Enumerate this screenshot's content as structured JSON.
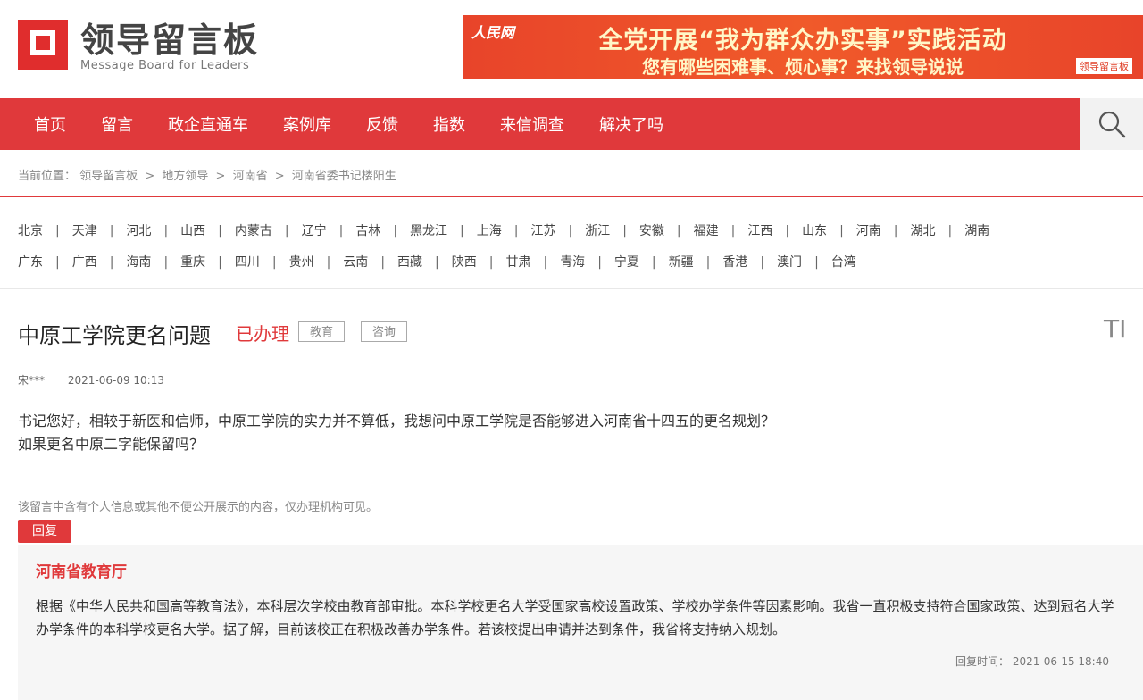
{
  "header": {
    "logo_cn": "领导留言板",
    "logo_en": "Message Board for Leaders",
    "banner_brand": "人民网",
    "banner_line1": "全党开展“我为群众办实事”实践活动",
    "banner_line2": "您有哪些困难事、烦心事？来找领导说说",
    "banner_tag": "领导留言板"
  },
  "nav": {
    "items": [
      "首页",
      "留言",
      "政企直通车",
      "案例库",
      "反馈",
      "指数",
      "来信调查",
      "解决了吗"
    ]
  },
  "breadcrumb": {
    "label": "当前位置：",
    "items": [
      "领导留言板",
      "地方领导",
      "河南省",
      "河南省委书记楼阳生"
    ]
  },
  "provinces": {
    "row1": [
      "北京",
      "天津",
      "河北",
      "山西",
      "内蒙古",
      "辽宁",
      "吉林",
      "黑龙江",
      "上海",
      "江苏",
      "浙江",
      "安徽",
      "福建",
      "江西",
      "山东",
      "河南",
      "湖北",
      "湖南"
    ],
    "row2": [
      "广东",
      "广西",
      "海南",
      "重庆",
      "四川",
      "贵州",
      "云南",
      "西藏",
      "陕西",
      "甘肃",
      "青海",
      "宁夏",
      "新疆",
      "香港",
      "澳门",
      "台湾"
    ]
  },
  "message": {
    "title": "中原工学院更名问题",
    "status": "已办理",
    "tag1": "教育",
    "tag2": "咨询",
    "font_icon": "TI",
    "author": "宋***",
    "date": "2021-06-09 10:13",
    "body_line1": "书记您好，相较于新医和信师，中原工学院的实力并不算低，我想问中原工学院是否能够进入河南省十四五的更名规划？",
    "body_line2": "如果更名中原二字能保留吗？",
    "privacy_note": "该留言中含有个人信息或其他不便公开展示的内容，仅办理机构可见。"
  },
  "reply": {
    "tag": "回复",
    "org": "河南省教育厅",
    "body": "根据《中华人民共和国高等教育法》，本科层次学校由教育部审批。本科学校更名大学受国家高校设置政策、学校办学条件等因素影响。我省一直积极支持符合国家政策、达到冠名大学办学条件的本科学校更名大学。据了解，目前该校正在积极改善办学条件。若该校提出申请并达到条件，我省将支持纳入规划。",
    "time_label": "回复时间：",
    "time": "2021-06-15 18:40"
  },
  "colors": {
    "accent": "#e0393b"
  }
}
